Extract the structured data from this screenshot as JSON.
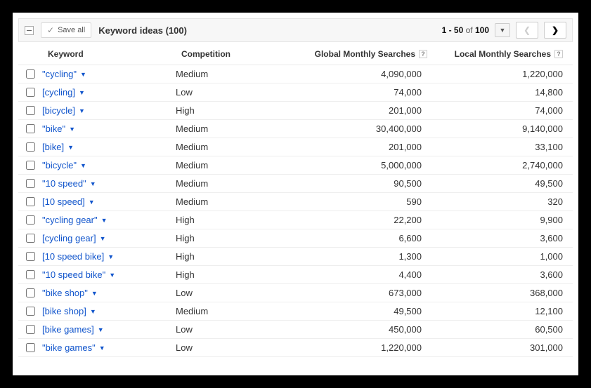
{
  "header": {
    "save_all_label": "Save all",
    "title": "Keyword ideas (100)",
    "range_prefix": "1 - 50",
    "range_of": "of",
    "total": "100"
  },
  "columns": {
    "keyword": "Keyword",
    "competition": "Competition",
    "global": "Global Monthly Searches",
    "local": "Local Monthly Searches"
  },
  "rows": [
    {
      "keyword": "\"cycling\"",
      "competition": "Medium",
      "global": "4,090,000",
      "local": "1,220,000"
    },
    {
      "keyword": "[cycling]",
      "competition": "Low",
      "global": "74,000",
      "local": "14,800"
    },
    {
      "keyword": "[bicycle]",
      "competition": "High",
      "global": "201,000",
      "local": "74,000"
    },
    {
      "keyword": "\"bike\"",
      "competition": "Medium",
      "global": "30,400,000",
      "local": "9,140,000"
    },
    {
      "keyword": "[bike]",
      "competition": "Medium",
      "global": "201,000",
      "local": "33,100"
    },
    {
      "keyword": "\"bicycle\"",
      "competition": "Medium",
      "global": "5,000,000",
      "local": "2,740,000"
    },
    {
      "keyword": "\"10 speed\"",
      "competition": "Medium",
      "global": "90,500",
      "local": "49,500"
    },
    {
      "keyword": "[10 speed]",
      "competition": "Medium",
      "global": "590",
      "local": "320"
    },
    {
      "keyword": "\"cycling gear\"",
      "competition": "High",
      "global": "22,200",
      "local": "9,900"
    },
    {
      "keyword": "[cycling gear]",
      "competition": "High",
      "global": "6,600",
      "local": "3,600"
    },
    {
      "keyword": "[10 speed bike]",
      "competition": "High",
      "global": "1,300",
      "local": "1,000"
    },
    {
      "keyword": "\"10 speed bike\"",
      "competition": "High",
      "global": "4,400",
      "local": "3,600"
    },
    {
      "keyword": "\"bike shop\"",
      "competition": "Low",
      "global": "673,000",
      "local": "368,000"
    },
    {
      "keyword": "[bike shop]",
      "competition": "Medium",
      "global": "49,500",
      "local": "12,100"
    },
    {
      "keyword": "[bike games]",
      "competition": "Low",
      "global": "450,000",
      "local": "60,500"
    },
    {
      "keyword": "\"bike games\"",
      "competition": "Low",
      "global": "1,220,000",
      "local": "301,000"
    }
  ]
}
